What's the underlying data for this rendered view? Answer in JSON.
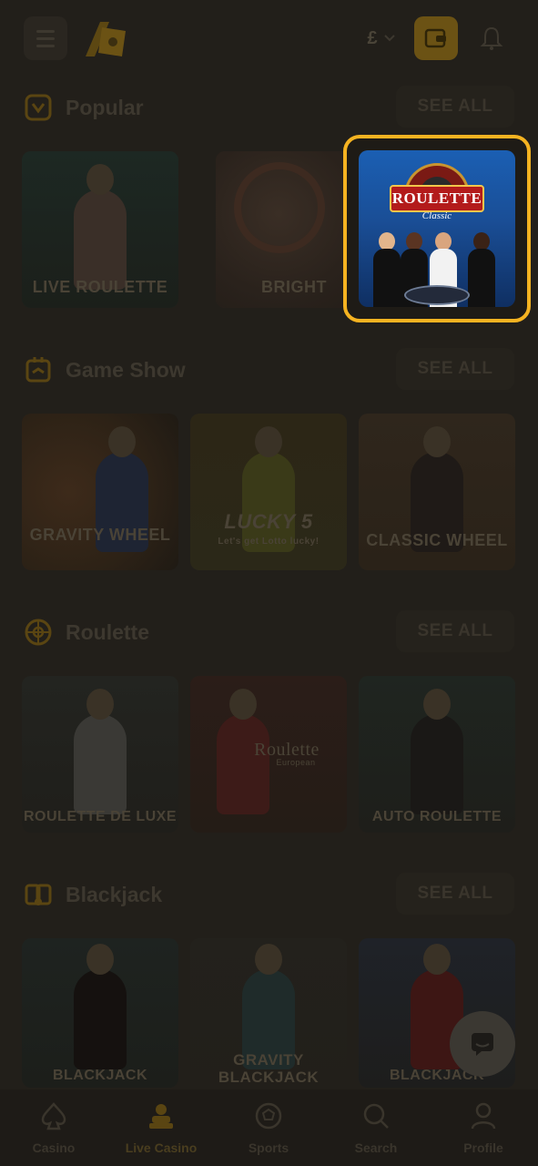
{
  "header": {
    "currency": "£",
    "menu_icon": "hamburger-icon",
    "logo_icon": "brand-logo",
    "wallet_icon": "wallet-icon",
    "bell_icon": "bell-icon",
    "accent_color": "#f5b321"
  },
  "sections": [
    {
      "title": "Popular",
      "see_all": "SEE ALL",
      "icon": "popular-badge-icon",
      "cards": [
        {
          "label": "LIVE ROULETTE"
        },
        {
          "label": "BRIGHT"
        },
        {
          "label": "ROULETTE",
          "sublabel": "Classic",
          "highlighted": true
        }
      ]
    },
    {
      "title": "Game Show",
      "see_all": "SEE ALL",
      "icon": "game-show-icon",
      "cards": [
        {
          "label": "GRAVITY WHEEL"
        },
        {
          "label": "LUCKY 5",
          "sublabel": "Let's get Lotto lucky!"
        },
        {
          "label": "CLASSIC WHEEL"
        }
      ]
    },
    {
      "title": "Roulette",
      "see_all": "SEE ALL",
      "icon": "roulette-icon",
      "cards": [
        {
          "label": "ROULETTE DE LUXE"
        },
        {
          "label": "Roulette",
          "sublabel": "European"
        },
        {
          "label": "AUTO ROULETTE"
        }
      ]
    },
    {
      "title": "Blackjack",
      "see_all": "SEE ALL",
      "icon": "blackjack-icon",
      "cards": [
        {
          "label": "BLACKJACK"
        },
        {
          "label": "GRAVITY BLACKJACK"
        },
        {
          "label": "BLACKJACK"
        }
      ]
    }
  ],
  "bottom_nav": [
    {
      "label": "Casino",
      "icon": "spade-icon"
    },
    {
      "label": "Live Casino",
      "icon": "live-dealer-icon",
      "active": true
    },
    {
      "label": "Sports",
      "icon": "soccer-ball-icon"
    },
    {
      "label": "Search",
      "icon": "search-icon"
    },
    {
      "label": "Profile",
      "icon": "user-icon"
    }
  ]
}
